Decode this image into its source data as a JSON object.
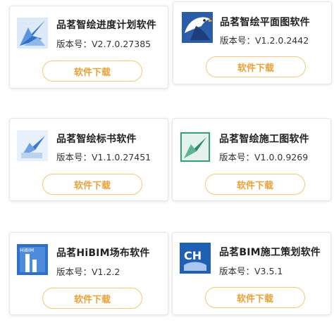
{
  "cards": [
    {
      "name": "品茗智绘进度计划软件",
      "version": "版本号：V2.7.0.27385",
      "button": "软件下载",
      "icon": "progress-plan-bird-icon"
    },
    {
      "name": "品茗智绘平面图软件",
      "version": "版本号：V1.2.0.2442",
      "button": "软件下载",
      "icon": "floor-plan-eagle-icon"
    },
    {
      "name": "品茗智绘标书软件",
      "version": "版本号：V1.1.0.27451",
      "button": "软件下载",
      "icon": "tender-doc-bird-icon"
    },
    {
      "name": "品茗智绘施工图软件",
      "version": "版本号：V1.0.0.9269",
      "button": "软件下载",
      "icon": "construction-drawing-bird-icon"
    },
    {
      "name": "品茗HiBIM场布软件",
      "version": "版本号：V1.2.2",
      "button": "软件下载",
      "icon": "hibim-site-layout-icon",
      "icon_text": "HiBIM"
    },
    {
      "name": "品茗BIM施工策划软件",
      "version": "版本号：V3.5.1",
      "button": "软件下载",
      "icon": "bim-construction-planning-icon",
      "icon_text": "CH"
    }
  ],
  "colors": {
    "button_text": "#e8a23a",
    "button_border": "#f5c77a",
    "icon_blue": "#2e6fc8"
  }
}
